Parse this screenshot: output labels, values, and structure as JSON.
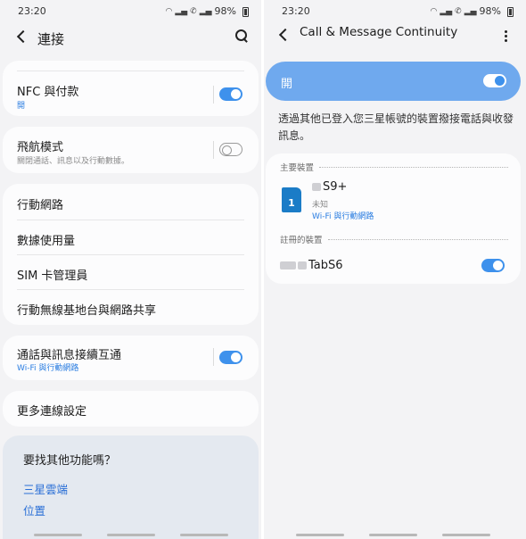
{
  "left": {
    "status": {
      "time": "23:20",
      "battery": "98%"
    },
    "header": {
      "title": "連接"
    },
    "nfc": {
      "title": "NFC 與付款",
      "sub": "開",
      "toggle_on": true
    },
    "airplane": {
      "title": "飛航模式",
      "sub": "關閉通話、訊息以及行動數據。",
      "toggle_on": false
    },
    "menu": {
      "mobile": "行動網路",
      "data": "數據使用量",
      "sim": "SIM 卡管理員",
      "hotspot": "行動無線基地台與網路共享"
    },
    "continuity": {
      "title": "通話與訊息接續互通",
      "sub": "Wi-Fi 與行動網路",
      "toggle_on": true
    },
    "more": {
      "title": "更多連線設定"
    },
    "lookingfor": {
      "question": "要找其他功能嗎？",
      "link1": "三星雲端",
      "link2": "位置"
    }
  },
  "right": {
    "status": {
      "time": "23:20",
      "battery": "98%"
    },
    "header": {
      "title": "Call & Message Continuity"
    },
    "master": {
      "label": "開",
      "toggle_on": true
    },
    "description": "透過其他已登入您三星帳號的裝置撥接電話與收發訊息。",
    "main_section": "主要裝置",
    "main_device": {
      "name": "S9+",
      "status": "未知",
      "connection": "Wi-Fi 與行動網路",
      "sim_number": "1"
    },
    "registered_section": "註冊的裝置",
    "registered_device": {
      "name": "TabS6",
      "toggle_on": true
    }
  },
  "colors": {
    "accent": "#3e91ec",
    "banner": "#6fa9ee",
    "link": "#2a6fd6"
  }
}
